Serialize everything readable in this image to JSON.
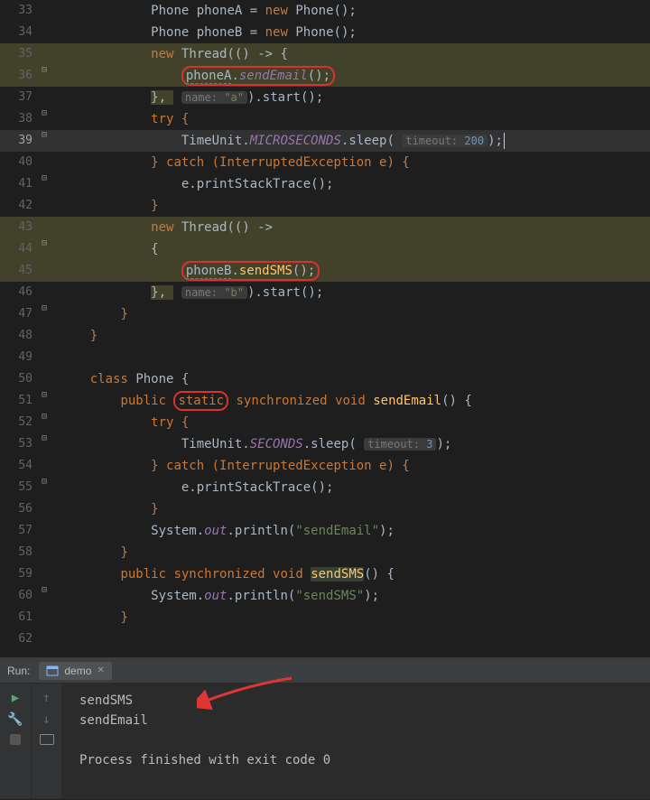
{
  "run": {
    "label": "Run:",
    "tab": "demo"
  },
  "console": {
    "out1": "sendSMS",
    "out2": "sendEmail",
    "exit": "Process finished with exit code 0"
  },
  "gutter": {
    "33": "33",
    "34": "34",
    "35": "35",
    "36": "36",
    "37": "37",
    "38": "38",
    "39": "39",
    "40": "40",
    "41": "41",
    "42": "42",
    "43": "43",
    "44": "44",
    "45": "45",
    "46": "46",
    "47": "47",
    "48": "48",
    "49": "49",
    "50": "50",
    "51": "51",
    "52": "52",
    "53": "53",
    "54": "54",
    "55": "55",
    "56": "56",
    "57": "57",
    "58": "58",
    "59": "59",
    "60": "60",
    "61": "61",
    "62": "62"
  },
  "t": {
    "Phone": "Phone",
    "phoneA": "phoneA",
    "phoneB": "phoneB",
    "eq": " = ",
    "new": "new",
    "Thread": "Thread",
    "arrow": "() -> {",
    "sendEmail": "sendEmail",
    "sendSMS": "sendSMS",
    "nameHint": "name:",
    "aStr": "\"a\"",
    "bStr": "\"b\"",
    "start": ".start();",
    "trybr": "try {",
    "catchbr": "} catch (InterruptedException e) {",
    "printStack": "e.printStackTrace();",
    "cbrace": "}",
    "TimeUnit": "TimeUnit",
    "MICRO": "MICROSECONDS",
    "SECONDS": "SECONDS",
    "sleep": ".sleep(",
    "timeoutHint": "timeout:",
    "n200": "200",
    "n3": "3",
    "klass": "class",
    "public": "public",
    "static": "static",
    "sync": "synchronized",
    "void": "void",
    "System": "System",
    "out": "out",
    "println": ".println(",
    "sendEmailStr": "\"sendEmail\"",
    "sendSMSStr": "\"sendSMS\"",
    "obrace": "{"
  }
}
